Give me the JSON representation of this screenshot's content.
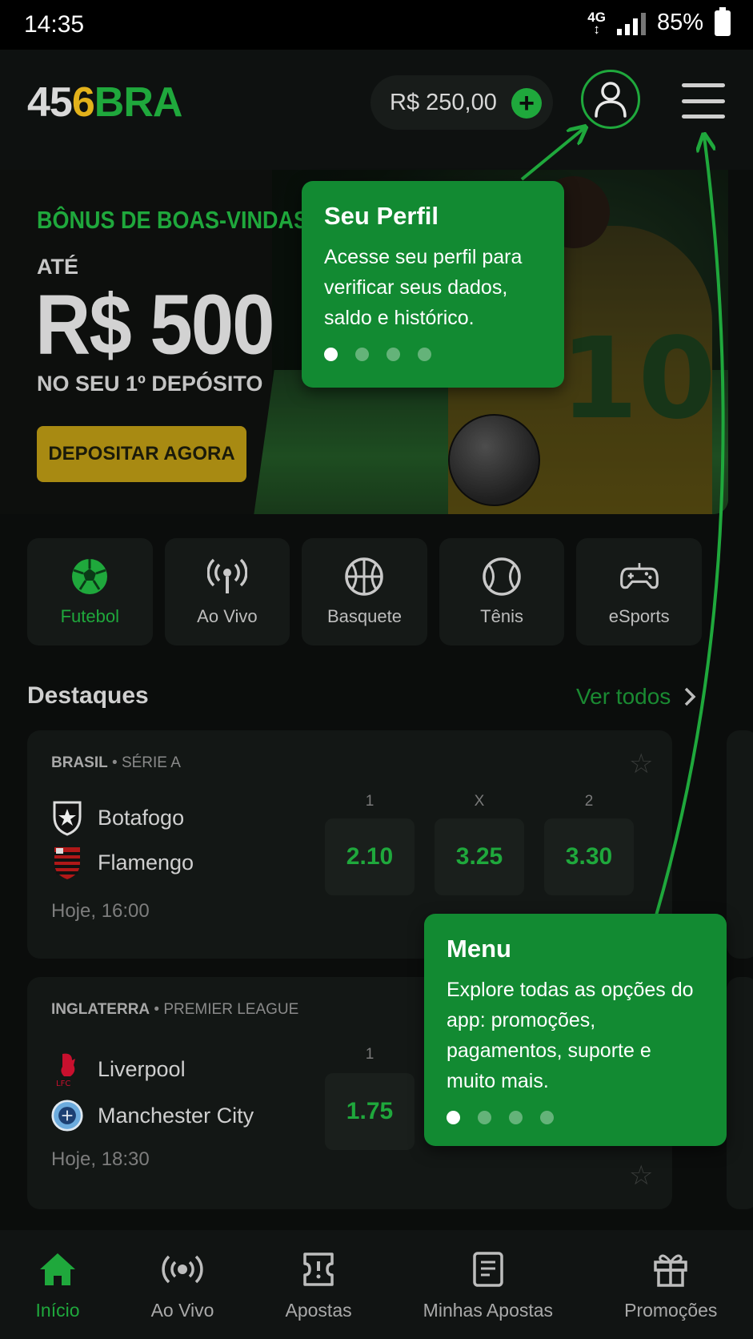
{
  "status_bar": {
    "time": "14:35",
    "network": "4G",
    "network_sub": "↕",
    "battery": "85%"
  },
  "header": {
    "logo_a": "45",
    "logo_b": "6",
    "logo_c": "BRA",
    "balance": "R$ 250,00",
    "add_symbol": "+"
  },
  "banner": {
    "kicker": "BÔNUS DE BOAS-VINDAS",
    "ate": "ATÉ",
    "amount": "R$ 500",
    "subtitle": "NO SEU 1º DEPÓSITO",
    "cta": "DEPOSITAR AGORA",
    "jersey_number": "10"
  },
  "categories": [
    {
      "label": "Futebol",
      "icon": "soccer-ball-icon",
      "active": true
    },
    {
      "label": "Ao Vivo",
      "icon": "broadcast-icon",
      "active": false
    },
    {
      "label": "Basquete",
      "icon": "basketball-icon",
      "active": false
    },
    {
      "label": "Tênis",
      "icon": "tennis-ball-icon",
      "active": false
    },
    {
      "label": "eSports",
      "icon": "gamepad-icon",
      "active": false
    }
  ],
  "highlights": {
    "title": "Destaques",
    "see_all": "Ver todos"
  },
  "matches": [
    {
      "country": "BRASIL",
      "league": "SÉRIE A",
      "home": "Botafogo",
      "away": "Flamengo",
      "time": "Hoje, 16:00",
      "odd_labels": [
        "1",
        "X",
        "2"
      ],
      "odds": [
        "2.10",
        "3.25",
        "3.30"
      ]
    },
    {
      "country": "INGLATERRA",
      "league": "PREMIER LEAGUE",
      "home": "Liverpool",
      "away": "Manchester City",
      "time": "Hoje, 18:30",
      "odd_labels": [
        "1"
      ],
      "odds": [
        "1.75"
      ]
    }
  ],
  "tooltips": {
    "profile": {
      "title": "Seu Perfil",
      "body": "Acesse seu perfil para verificar seus dados, saldo e histórico."
    },
    "menu": {
      "title": "Menu",
      "body": "Explore todas as opções do app: promoções, pagamentos, suporte e muito mais."
    }
  },
  "bottom_nav": [
    {
      "label": "Início",
      "icon": "home-icon",
      "active": true
    },
    {
      "label": "Ao Vivo",
      "icon": "live-icon",
      "active": false
    },
    {
      "label": "Apostas",
      "icon": "ticket-icon",
      "active": false
    },
    {
      "label": "Minhas Apostas",
      "icon": "receipt-icon",
      "active": false
    },
    {
      "label": "Promoções",
      "icon": "gift-icon",
      "active": false
    }
  ],
  "colors": {
    "accent": "#1fa83c",
    "gold": "#e3b21b",
    "tooltip": "#128a32",
    "background": "#0b0d0c"
  }
}
